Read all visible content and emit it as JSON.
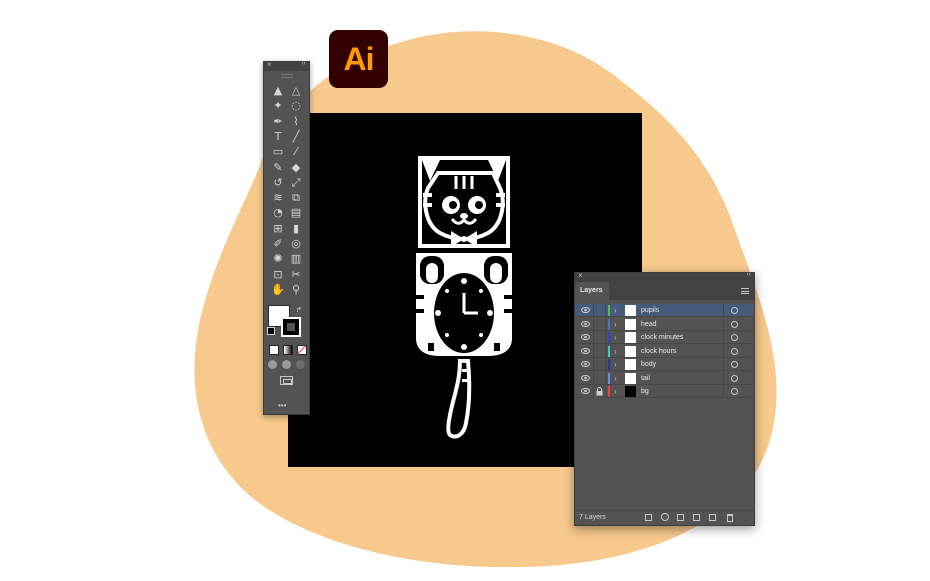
{
  "app": {
    "logo_text": "Ai",
    "logo_bg": "#330000",
    "logo_fg": "#ff9a00"
  },
  "background": {
    "blob_color": "#f7c98c"
  },
  "tools_panel": {
    "close_glyph": "×",
    "collapse_glyph": "‹‹",
    "more_glyph": "•••",
    "tools": [
      "selection-tool",
      "direct-selection-tool",
      "magic-wand-tool",
      "lasso-tool",
      "pen-tool",
      "curvature-tool",
      "type-tool",
      "line-segment-tool",
      "rectangle-tool",
      "paintbrush-tool",
      "shaper-tool",
      "eraser-tool",
      "rotate-tool",
      "scale-tool",
      "width-tool",
      "free-transform-tool",
      "shape-builder-tool",
      "perspective-grid-tool",
      "mesh-tool",
      "gradient-tool",
      "eyedropper-tool",
      "blend-tool",
      "symbol-sprayer-tool",
      "column-graph-tool",
      "artboard-tool",
      "slice-tool",
      "hand-tool",
      "zoom-tool"
    ],
    "fill_color": "#ffffff",
    "stroke_color": "#000000"
  },
  "layers_panel": {
    "close_glyph": "×",
    "collapse_glyph": "‹‹",
    "tab_label": "Layers",
    "count_label": "7 Layers",
    "layers": [
      {
        "name": "pupils",
        "color": "#4fbf4f",
        "selected": true,
        "locked": false
      },
      {
        "name": "head",
        "color": "#4f6fcf",
        "selected": false,
        "locked": false
      },
      {
        "name": "clock minutes",
        "color": "#3f3fcf",
        "selected": false,
        "locked": false
      },
      {
        "name": "clock hours",
        "color": "#3fcfb0",
        "selected": false,
        "locked": false
      },
      {
        "name": "body",
        "color": "#2f2f9f",
        "selected": false,
        "locked": false
      },
      {
        "name": "tail",
        "color": "#5f8fef",
        "selected": false,
        "locked": false
      },
      {
        "name": "bg",
        "color": "#ef3f3f",
        "selected": false,
        "locked": true
      }
    ]
  }
}
